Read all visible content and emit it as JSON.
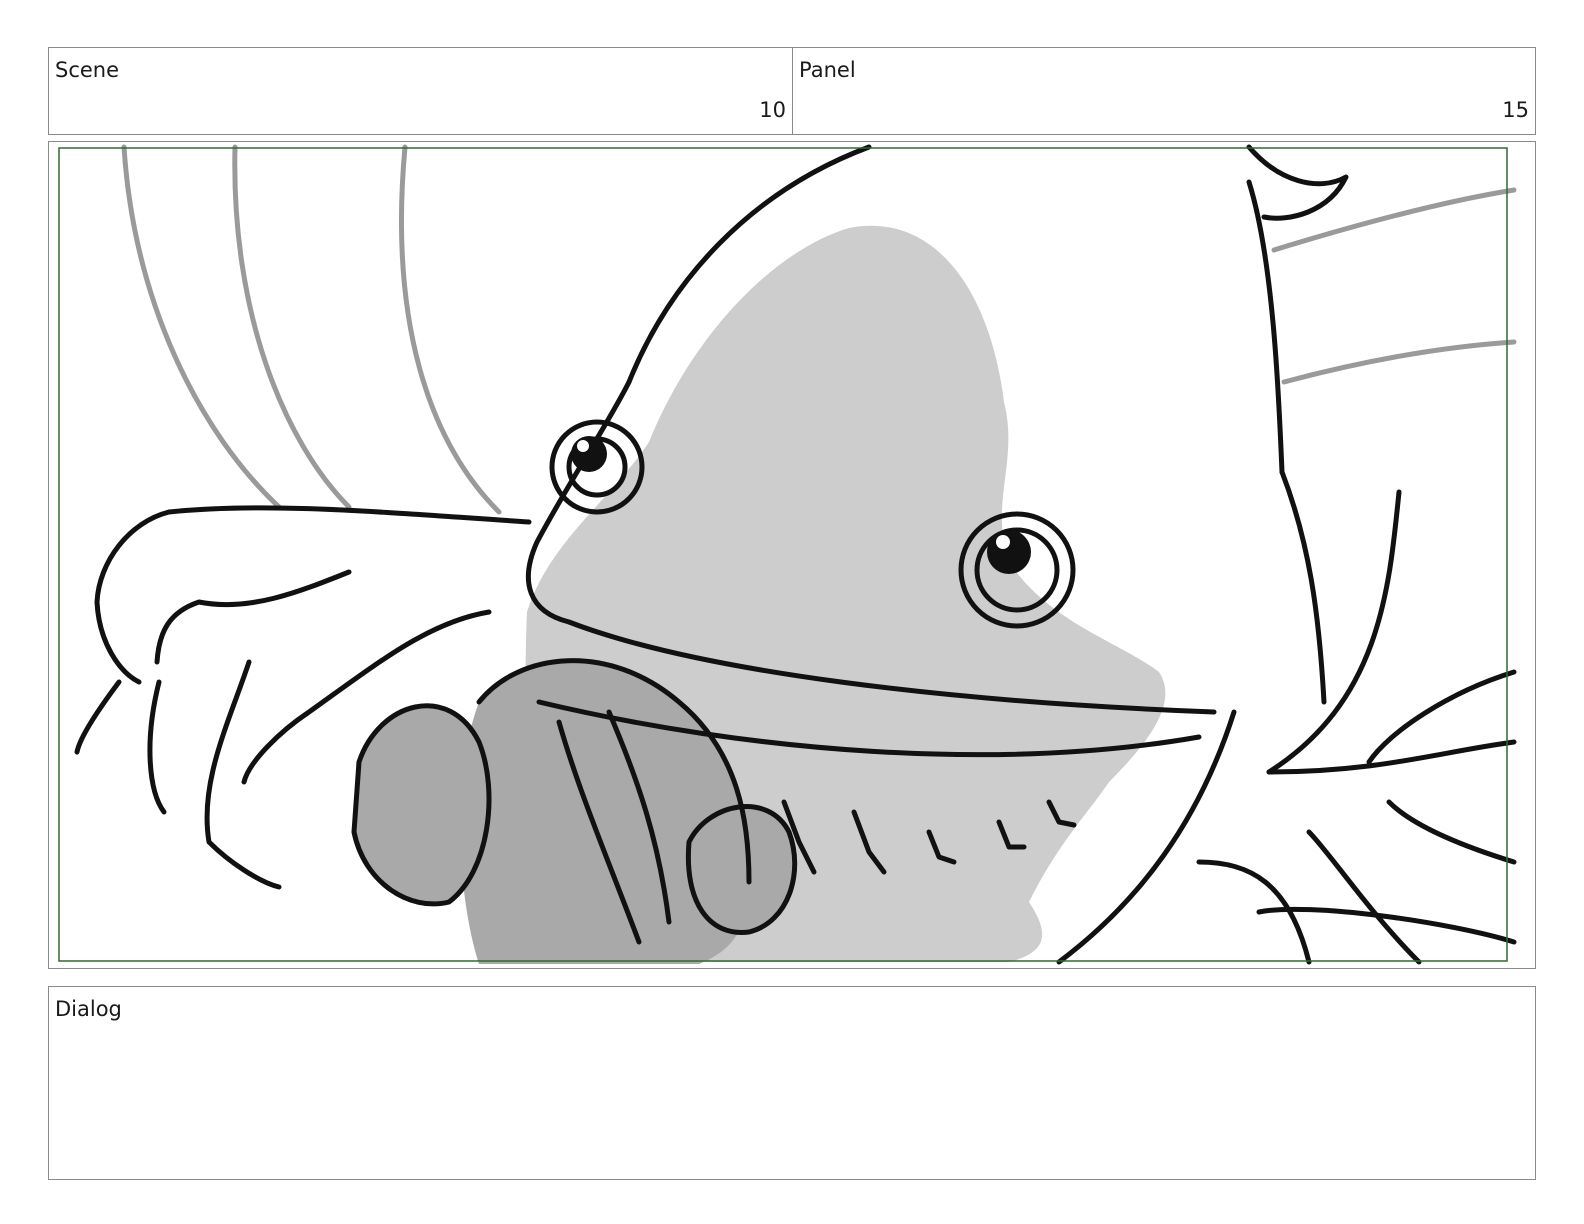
{
  "header": {
    "scene": {
      "label": "Scene",
      "value": "10"
    },
    "panel": {
      "label": "Panel",
      "value": "15"
    }
  },
  "frame": {
    "safe_area_color": "#2e6b2e",
    "artwork": "storyboard-sketch"
  },
  "dialog": {
    "label": "Dialog",
    "text": ""
  }
}
